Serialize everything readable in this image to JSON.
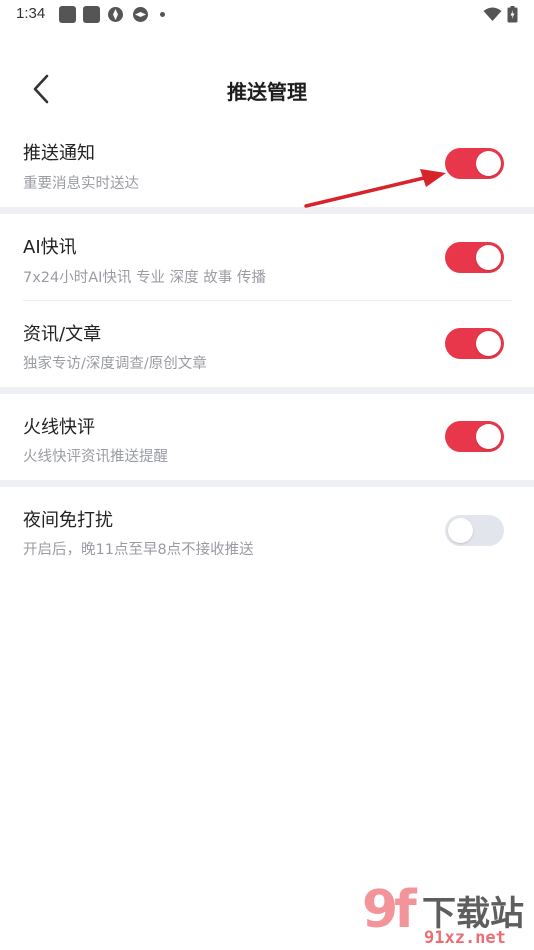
{
  "status_bar": {
    "time": "1:34"
  },
  "header": {
    "title": "推送管理"
  },
  "settings": [
    {
      "title": "推送通知",
      "subtitle": "重要消息实时送达",
      "enabled": true
    },
    {
      "title": "AI快讯",
      "subtitle": "7x24小时AI快讯 专业 深度 故事 传播",
      "enabled": true
    },
    {
      "title": "资讯/文章",
      "subtitle": "独家专访/深度调查/原创文章",
      "enabled": true
    },
    {
      "title": "火线快评",
      "subtitle": "火线快评资讯推送提醒",
      "enabled": true
    },
    {
      "title": "夜间免打扰",
      "subtitle": "开启后，晚11点至早8点不接收推送",
      "enabled": false
    }
  ],
  "colors": {
    "toggle_on": "#e8374a",
    "toggle_off": "#e2e6ec",
    "section_gap": "#eef0f4",
    "annotation_arrow": "#d8232a"
  },
  "watermark": {
    "logo": "9f",
    "name": "下载站",
    "url": "91xz.net"
  }
}
